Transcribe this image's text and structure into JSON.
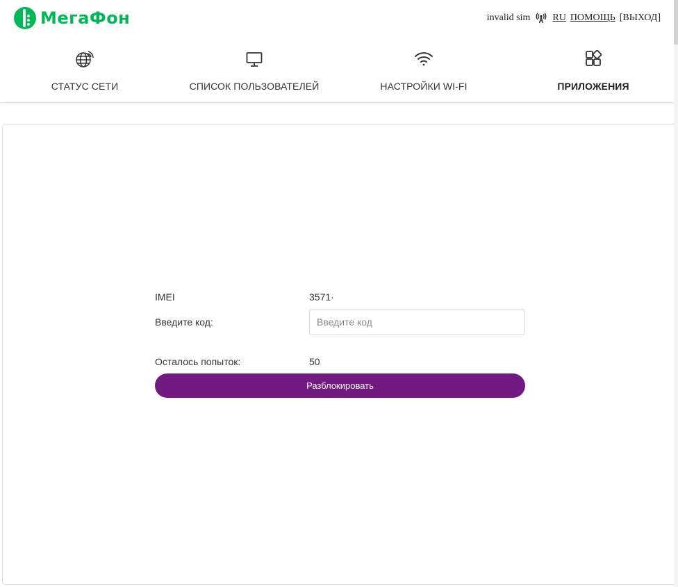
{
  "brand": {
    "name": "МегаФон",
    "color": "#00b956",
    "accent": "#731982"
  },
  "header": {
    "sim_status": "invalid sim",
    "signal_icon": "antenna-signal-icon",
    "language": "RU",
    "help": "ПОМОЩЬ",
    "logout": "[ВЫХОД]"
  },
  "nav": {
    "items": [
      {
        "label": "СТАТУС СЕТИ",
        "icon": "globe-icon",
        "active": false
      },
      {
        "label": "СПИСОК ПОЛЬЗОВАТЕЛЕЙ",
        "icon": "monitor-icon",
        "active": false
      },
      {
        "label": "НАСТРОЙКИ WI-FI",
        "icon": "wifi-icon",
        "active": false
      },
      {
        "label": "ПРИЛОЖЕНИЯ",
        "icon": "apps-grid-icon",
        "active": true
      }
    ]
  },
  "unlock_form": {
    "imei_label": "IMEI",
    "imei_value": "3571·",
    "code_label": "Введите код:",
    "code_placeholder": "Введите код",
    "code_value": "",
    "attempts_label": "Осталось попыток:",
    "attempts_value": "50",
    "submit_label": "Разблокировать"
  }
}
